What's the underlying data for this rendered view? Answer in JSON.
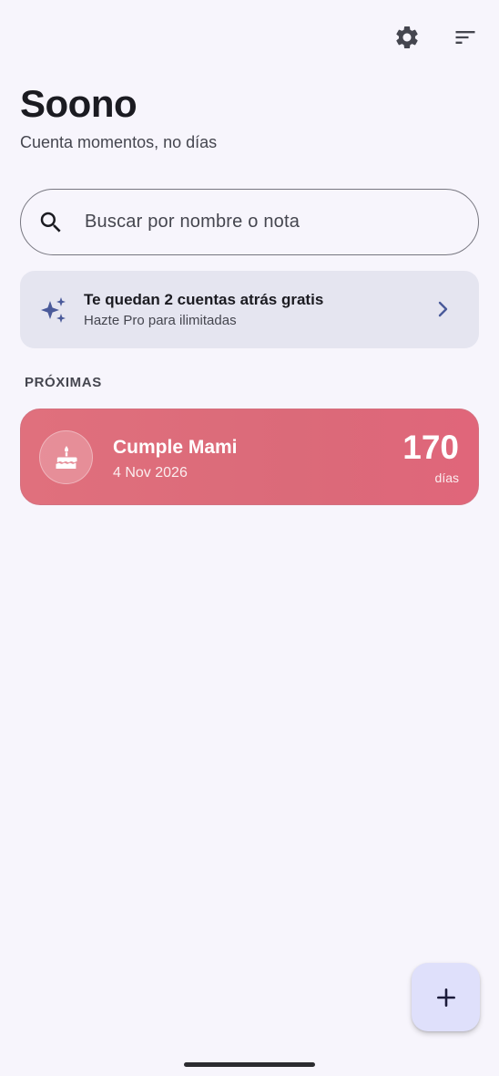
{
  "header": {
    "settings_icon": "gear-icon",
    "sort_icon": "sort-icon",
    "title": "Soono",
    "subtitle": "Cuenta momentos, no días"
  },
  "search": {
    "icon": "search-icon",
    "placeholder": "Buscar por nombre o nota",
    "value": ""
  },
  "promo": {
    "icon": "sparkles-icon",
    "title": "Te quedan 2 cuentas atrás gratis",
    "subtitle": "Hazte Pro para ilimitadas",
    "chevron_icon": "chevron-right-icon"
  },
  "sections": [
    {
      "label": "PRÓXIMAS",
      "events": [
        {
          "icon": "cake-icon",
          "name": "Cumple Mami",
          "date": "4 Nov 2026",
          "count": "170",
          "unit": "días",
          "color": "#de6b7a"
        }
      ]
    }
  ],
  "fab": {
    "icon": "plus-icon"
  },
  "colors": {
    "background": "#f7f5fc",
    "promo_background": "#e5e5f0",
    "accent": "#4a5a9a",
    "card": "#de6b7a",
    "fab": "#dfe0fb"
  }
}
